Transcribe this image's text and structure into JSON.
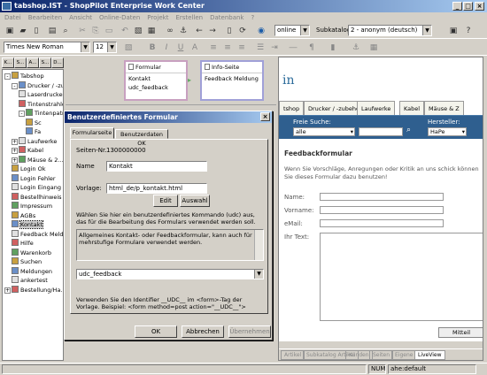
{
  "window": {
    "title": "tabshop.IST - ShopPilot Enterprise Work Center"
  },
  "menu": [
    "Datei",
    "Bearbeiten",
    "Ansicht",
    "Online-Daten",
    "Projekt",
    "Erstellen",
    "Datenbank",
    "?"
  ],
  "toolbar": {
    "mode_value": "online",
    "subkatalog_label": "Subkatalog",
    "subkatalog_value": "2 - anonym (deutsch)"
  },
  "format": {
    "font": "Times New Roman",
    "size": "12",
    "bold": "B",
    "italic": "I",
    "underline": "U",
    "align": "A"
  },
  "tree_tabs": [
    "K...",
    "S...",
    "A...",
    "S...",
    "D..."
  ],
  "tree": [
    {
      "label": "Tabshop",
      "indent": 0,
      "exp": "-"
    },
    {
      "label": "Drucker / -zubehör",
      "indent": 1,
      "exp": "-"
    },
    {
      "label": "Laserdrucker",
      "indent": 2,
      "exp": ""
    },
    {
      "label": "Tintenstrahldrucker",
      "indent": 2,
      "exp": ""
    },
    {
      "label": "Tintenpatronen",
      "indent": 2,
      "exp": "-"
    },
    {
      "label": "Sc",
      "indent": 3,
      "exp": ""
    },
    {
      "label": "Fa",
      "indent": 3,
      "exp": ""
    },
    {
      "label": "Laufwerke",
      "indent": 1,
      "exp": "+"
    },
    {
      "label": "Kabel",
      "indent": 1,
      "exp": "+"
    },
    {
      "label": "Mäuse & 2...",
      "indent": 1,
      "exp": "+"
    },
    {
      "label": "Login Ok",
      "indent": 1,
      "exp": ""
    },
    {
      "label": "Login Fehler",
      "indent": 1,
      "exp": ""
    },
    {
      "label": "Login Eingang",
      "indent": 1,
      "exp": ""
    },
    {
      "label": "Bestellhinweis",
      "indent": 1,
      "exp": ""
    },
    {
      "label": "Impressum",
      "indent": 1,
      "exp": ""
    },
    {
      "label": "AGBs",
      "indent": 1,
      "exp": ""
    },
    {
      "label": "Kontakt",
      "indent": 1,
      "exp": ""
    },
    {
      "label": "Feedback Meld...",
      "indent": 1,
      "exp": ""
    },
    {
      "label": "Hilfe",
      "indent": 1,
      "exp": ""
    },
    {
      "label": "Warenkorb",
      "indent": 1,
      "exp": ""
    },
    {
      "label": "Suchen",
      "indent": 1,
      "exp": ""
    },
    {
      "label": "Meldungen",
      "indent": 1,
      "exp": ""
    },
    {
      "label": "ankertest",
      "indent": 1,
      "exp": ""
    },
    {
      "label": "Bestellung/Ha...",
      "indent": 0,
      "exp": "+"
    }
  ],
  "flow": {
    "box1_title": "Formular",
    "box1_line1": "Kontakt",
    "box1_line2": "udc_feedback",
    "box2_title": "Info-Seite",
    "box2_line1": "Feedback Meldung"
  },
  "preview": {
    "logo": "in",
    "tabs": [
      "tshop",
      "Drucker / -zubehör",
      "Laufwerke",
      "Kabel",
      "Mäuse & Z"
    ],
    "search_label": "Freie Suche:",
    "search_value": "alle",
    "manufacturer_label": "Hersteller:",
    "manufacturer_value": "HaPe",
    "heading": "Feedbackformular",
    "intro": "Wenn Sie Vorschläge, Anregungen oder Kritik an uns schick können Sie dieses Formular dazu benutzen!",
    "name_label": "Name:",
    "vorname_label": "Vorname:",
    "email_label": "eMail:",
    "text_label": "Ihr Text:",
    "button": "Mitteil",
    "bottom_tabs": [
      "Artikel",
      "Subkatalog Artikel",
      "Kunden",
      "Seiten",
      "Eigene",
      "LiveView"
    ]
  },
  "dialog": {
    "title": "Benutzerdefiniertes Formular",
    "tab1": "Formularseite",
    "tab2": "Benutzerdaten OK",
    "seiten_label": "Seiten-Nr.",
    "seiten_value": "1300000000",
    "name_label": "Name",
    "name_value": "Kontakt",
    "vorlage_label": "Vorlage:",
    "vorlage_value": "html_de/p_kontakt.html",
    "edit": "Edit",
    "auswahl": "Auswahl",
    "hint": "Wählen Sie hier ein benutzerdefiniertes Kommando (udc) aus, das für die Bearbeitung des Formulars verwendet werden soll.",
    "desc": "Allgemeines Kontakt- oder Feedbackformular, kann auch für mehrstufige Formulare verwendet werden.",
    "udc_value": "udc_feedback",
    "footer": "Verwenden Sie den Identifier __UDC__ im <form>-Tag der Vorlage. Beispiel: <form method=post action=\"__UDC__\">",
    "ok": "OK",
    "cancel": "Abbrechen",
    "apply": "Übernehmen"
  },
  "status": {
    "num": "NUM",
    "user": "ahe:default"
  }
}
